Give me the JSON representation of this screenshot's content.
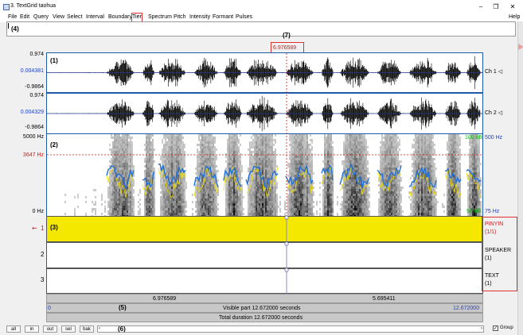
{
  "window": {
    "title": "3. TextGrid taohua",
    "minimize": "–",
    "maximize": "❐",
    "close": "✕"
  },
  "menu": [
    "File",
    "Edit",
    "Query",
    "View",
    "Select",
    "Interval",
    "Boundary",
    "Tier",
    "Spectrum",
    "Pitch",
    "Intensity",
    "Formant",
    "Pulses"
  ],
  "help": "Help",
  "annotations": {
    "a1": "(1)",
    "a2": "(2)",
    "a3": "(3)",
    "a4": "(4)",
    "a5": "(5)",
    "a6": "(6)",
    "a7": "(7)"
  },
  "cursor_time": "6.976589",
  "wave": {
    "ch1": {
      "top": "0.974",
      "mid": "0.004381",
      "bottom": "-0.9864",
      "label": "Ch 1"
    },
    "ch2": {
      "top": "0.974",
      "mid": "0.004329",
      "bottom": "-0.9864",
      "label": "Ch 2"
    }
  },
  "spectrogram": {
    "top": "5000 Hz",
    "cursor_freq": "3647 Hz",
    "bottom": "0 Hz",
    "intensity_top": "100 dB",
    "pitch_top": "500 Hz",
    "intensity_bottom": "50 dB",
    "pitch_bottom": "75 Hz"
  },
  "tiers": [
    {
      "number": "1",
      "name": "PINYIN",
      "count": "(1/1)"
    },
    {
      "number": "2",
      "name": "SPEAKER",
      "count": "(1)"
    },
    {
      "number": "3",
      "name": "TEXT",
      "count": "(1)"
    }
  ],
  "time_bar": {
    "left_dur": "6.976589",
    "right_dur": "5.695411",
    "start": "0",
    "visible": "Visible part 12.672000 seconds",
    "end": "12.672000",
    "total": "Total duration 12.672000 seconds"
  },
  "buttons": [
    "all",
    "in",
    "out",
    "sel",
    "bak"
  ],
  "group_label": "Group",
  "colors": {
    "selection": "#f5e800",
    "cursor": "#d21a1a",
    "pitch": "#1f6fd6",
    "intensity": "#f0e000"
  }
}
